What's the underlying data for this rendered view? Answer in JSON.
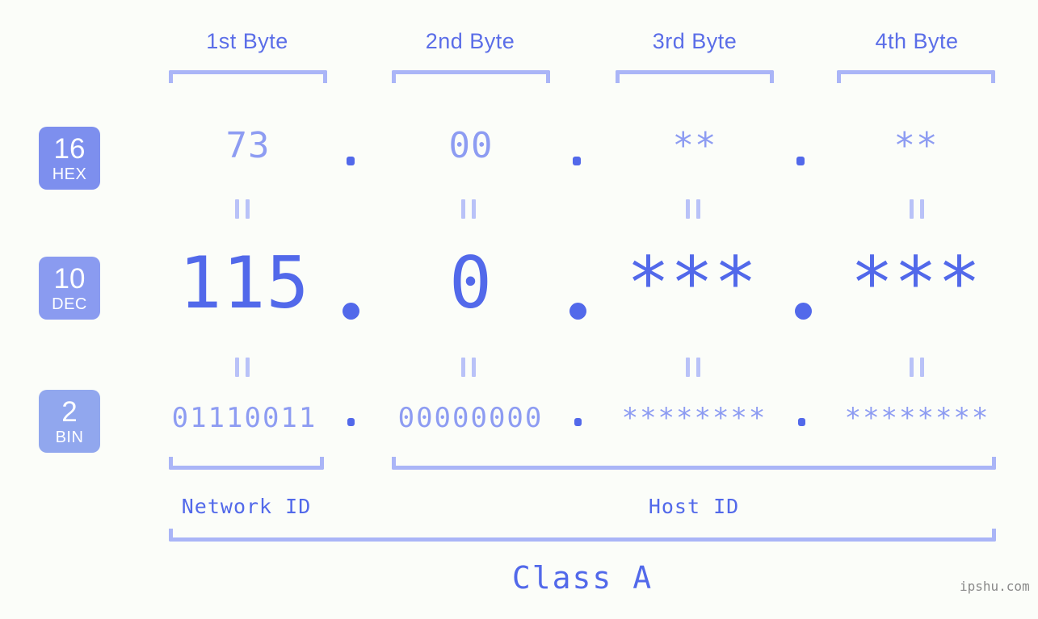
{
  "watermark": "ipshu.com",
  "colors": {
    "background": "#fbfdf9",
    "accent_strong": "#5269ea",
    "accent_mid": "#8d9cf2",
    "accent_light": "#aab5f7",
    "badge_hex": "#7d8fee",
    "badge_dec": "#8a9bf0",
    "badge_bin": "#91a7ee",
    "watermark": "#8a8a8a"
  },
  "byte_headers": [
    {
      "label": "1st Byte"
    },
    {
      "label": "2nd Byte"
    },
    {
      "label": "3rd Byte"
    },
    {
      "label": "4th Byte"
    }
  ],
  "bases": [
    {
      "number": "16",
      "name": "HEX"
    },
    {
      "number": "10",
      "name": "DEC"
    },
    {
      "number": "2",
      "name": "BIN"
    }
  ],
  "rows": {
    "hex": {
      "base_number": "16",
      "base_name": "HEX",
      "values": [
        "73",
        "00",
        "**",
        "**"
      ]
    },
    "dec": {
      "base_number": "10",
      "base_name": "DEC",
      "values": [
        "115",
        "0",
        "***",
        "***"
      ]
    },
    "bin": {
      "base_number": "2",
      "base_name": "BIN",
      "values": [
        "01110011",
        "00000000",
        "********",
        "********"
      ]
    }
  },
  "separator": ".",
  "connector": "=",
  "segments": {
    "network_id": "Network ID",
    "host_id": "Host ID",
    "class": "Class A"
  },
  "ip_summary": {
    "dotted_decimal": "115.0.***.***",
    "dotted_hex": "73.00.**.**",
    "dotted_binary": "01110011.00000000.********.********",
    "class": "Class A",
    "network_bytes": 1,
    "host_bytes": 3
  }
}
